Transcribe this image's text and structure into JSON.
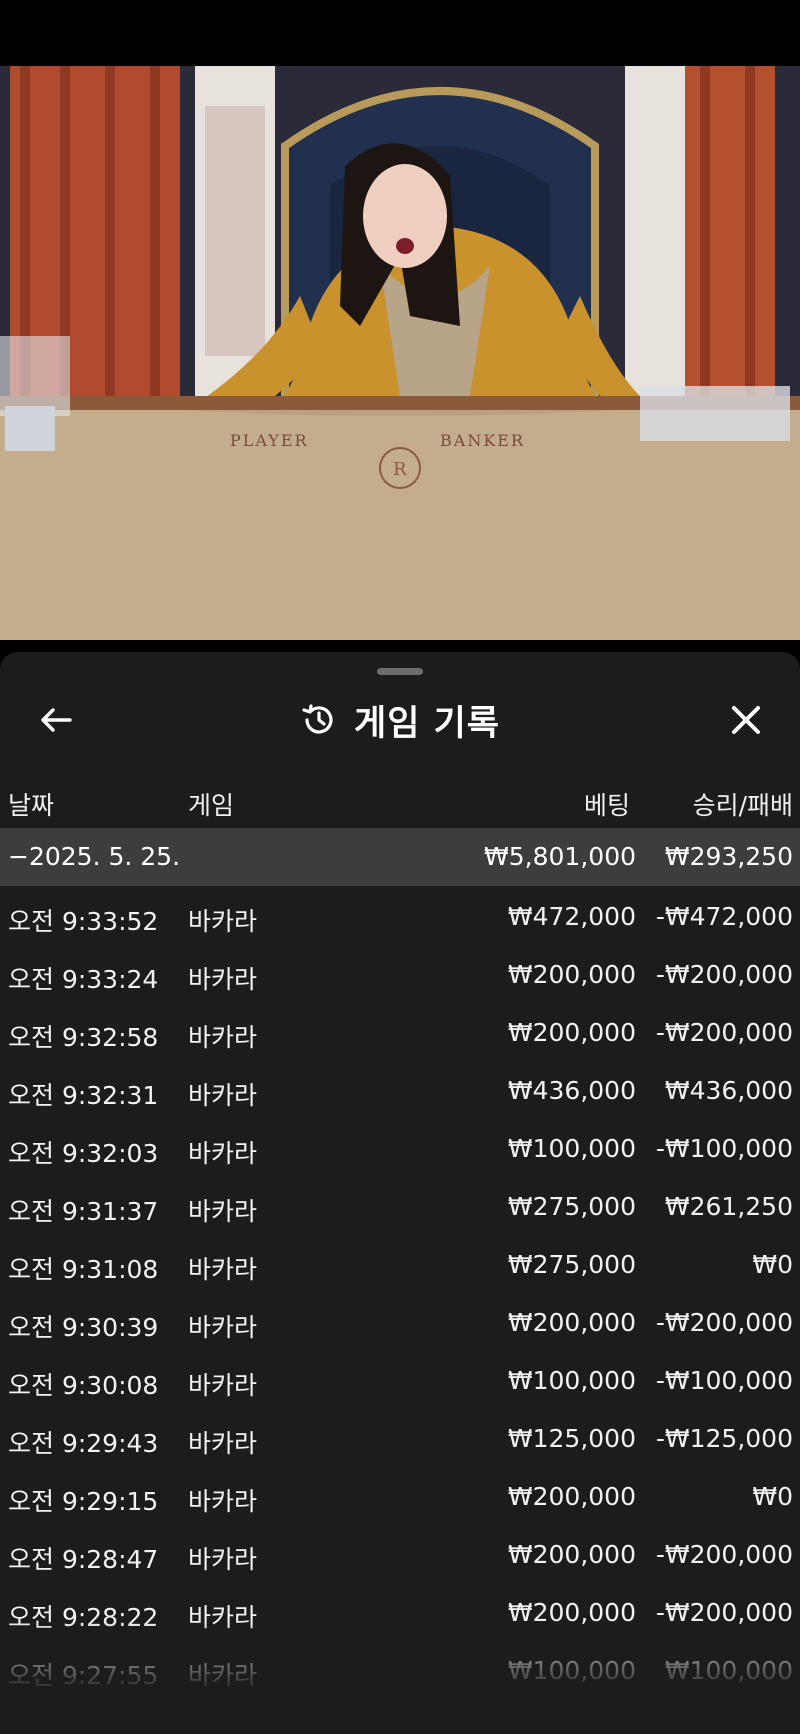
{
  "sheet": {
    "title": "게임 기록",
    "columns": {
      "date": "날짜",
      "game": "게임",
      "bet": "베팅",
      "result": "승리/패배"
    },
    "summary": {
      "date": "−2025. 5. 25.",
      "bet": "₩5,801,000",
      "result": "₩293,250"
    },
    "rows": [
      {
        "time": "오전 9:33:52",
        "game": "바카라",
        "bet": "₩472,000",
        "result": "-₩472,000"
      },
      {
        "time": "오전 9:33:24",
        "game": "바카라",
        "bet": "₩200,000",
        "result": "-₩200,000"
      },
      {
        "time": "오전 9:32:58",
        "game": "바카라",
        "bet": "₩200,000",
        "result": "-₩200,000"
      },
      {
        "time": "오전 9:32:31",
        "game": "바카라",
        "bet": "₩436,000",
        "result": "₩436,000"
      },
      {
        "time": "오전 9:32:03",
        "game": "바카라",
        "bet": "₩100,000",
        "result": "-₩100,000"
      },
      {
        "time": "오전 9:31:37",
        "game": "바카라",
        "bet": "₩275,000",
        "result": "₩261,250"
      },
      {
        "time": "오전 9:31:08",
        "game": "바카라",
        "bet": "₩275,000",
        "result": "₩0"
      },
      {
        "time": "오전 9:30:39",
        "game": "바카라",
        "bet": "₩200,000",
        "result": "-₩200,000"
      },
      {
        "time": "오전 9:30:08",
        "game": "바카라",
        "bet": "₩100,000",
        "result": "-₩100,000"
      },
      {
        "time": "오전 9:29:43",
        "game": "바카라",
        "bet": "₩125,000",
        "result": "-₩125,000"
      },
      {
        "time": "오전 9:29:15",
        "game": "바카라",
        "bet": "₩200,000",
        "result": "₩0"
      },
      {
        "time": "오전 9:28:47",
        "game": "바카라",
        "bet": "₩200,000",
        "result": "-₩200,000"
      },
      {
        "time": "오전 9:28:22",
        "game": "바카라",
        "bet": "₩200,000",
        "result": "-₩200,000"
      },
      {
        "time": "오전 9:27:55",
        "game": "바카라",
        "bet": "₩100,000",
        "result": "₩100,000"
      }
    ]
  },
  "video": {
    "table_labels": [
      "PLAYER",
      "BANKER"
    ]
  },
  "icons": {
    "back": "arrow-left-icon",
    "history": "history-icon",
    "close": "close-icon"
  },
  "colors": {
    "sheet_bg": "#1c1c1c",
    "summary_bg": "#3d3d3d",
    "text": "#ffffff"
  }
}
